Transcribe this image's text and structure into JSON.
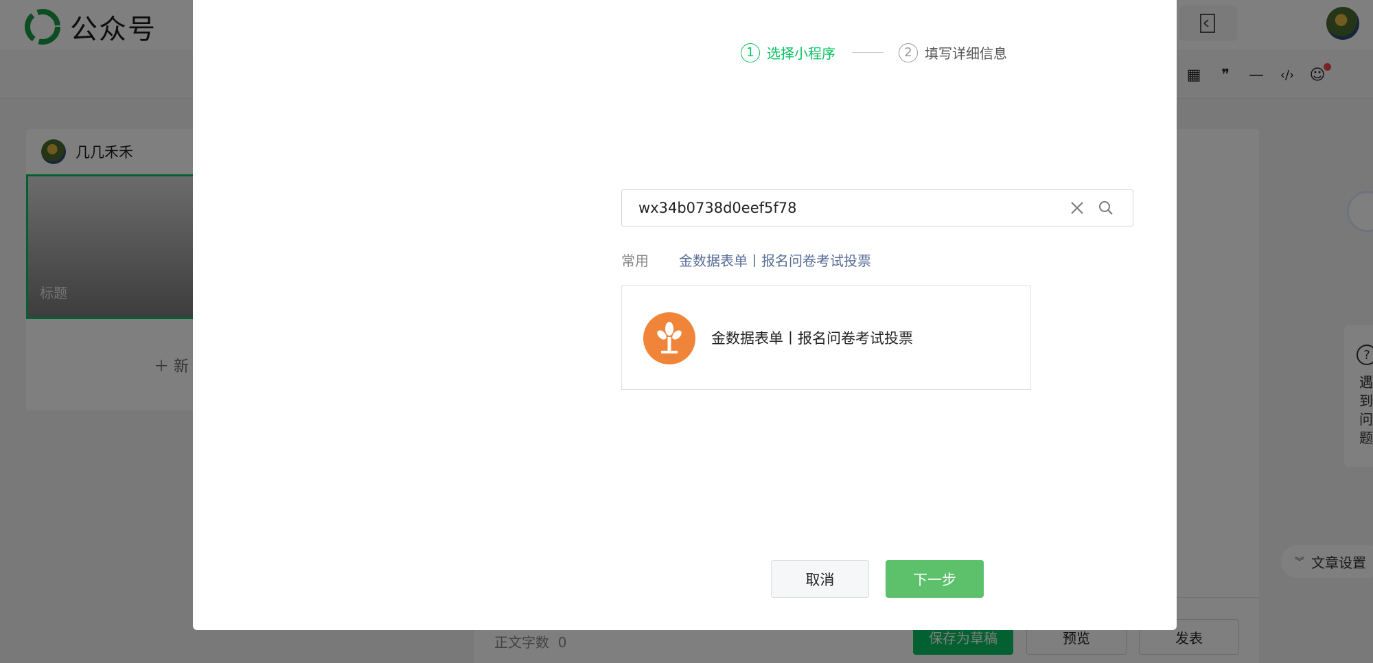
{
  "app": {
    "brand_name": "公众号"
  },
  "account": {
    "name": "几几禾禾"
  },
  "cover": {
    "title_placeholder": "标题"
  },
  "sidebar": {
    "new_article_label": "新"
  },
  "editor": {
    "word_count_label": "正文字数",
    "word_count_value": "0"
  },
  "footer": {
    "save_draft_label": "保存为草稿",
    "preview_label": "预览",
    "publish_label": "发表"
  },
  "help": {
    "icon": "question-icon",
    "text": "遇到问题"
  },
  "article_settings": {
    "label": "文章设置"
  },
  "toolbar": {
    "icons": [
      "table-icon",
      "quote-icon",
      "divider-icon",
      "code-icon",
      "emoji-icon"
    ]
  },
  "modal": {
    "steps": [
      {
        "num": "1",
        "label": "选择小程序",
        "active": true
      },
      {
        "num": "2",
        "label": "填写详细信息",
        "active": false
      }
    ],
    "search": {
      "value": "wx34b0738d0eef5f78"
    },
    "common": {
      "label": "常用",
      "link": "金数据表单丨报名问卷考试投票"
    },
    "result": {
      "name": "金数据表单丨报名问卷考试投票",
      "logo_color": "#f0853a"
    },
    "cancel_label": "取消",
    "next_label": "下一步"
  },
  "colors": {
    "brand_green": "#07c160",
    "next_button": "#5dc06b",
    "link": "#576b95"
  }
}
